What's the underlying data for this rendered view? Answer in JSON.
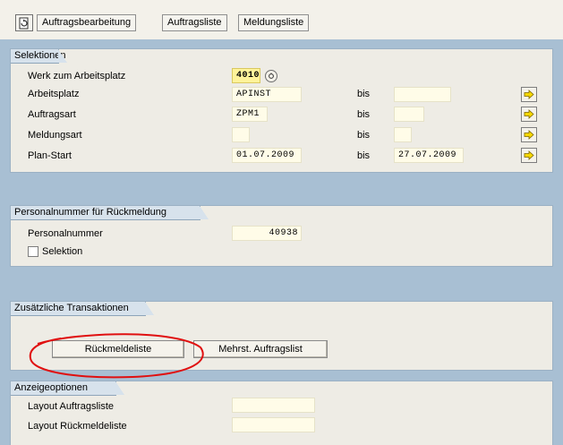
{
  "toolbar": {
    "icon": "document-refresh-icon",
    "buttons": [
      "Auftragsbearbeitung",
      "Auftragsliste",
      "Meldungsliste"
    ]
  },
  "selektionen": {
    "title": "Selektionen",
    "werk": {
      "label": "Werk zum Arbeitsplatz",
      "value": "4010"
    },
    "to_label": "bis",
    "rows": [
      {
        "label": "Arbeitsplatz",
        "from": "APINST",
        "to": ""
      },
      {
        "label": "Auftragsart",
        "from": "ZPM1",
        "to": ""
      },
      {
        "label": "Meldungsart",
        "from": "",
        "to": ""
      },
      {
        "label": "Plan-Start",
        "from": "01.07.2009",
        "to": "27.07.2009"
      }
    ]
  },
  "personal": {
    "title": "Personalnummer für Rückmeldung",
    "label": "Personalnummer",
    "value": "40938",
    "checkbox_label": "Selektion",
    "checked": false
  },
  "transaktionen": {
    "title": "Zusätzliche Transaktionen",
    "btn1": "Rückmeldeliste",
    "btn2": "Mehrst. Auftragslist"
  },
  "anzeige": {
    "title": "Anzeigeoptionen",
    "layout_auftragsliste": {
      "label": "Layout Auftragsliste",
      "value": ""
    },
    "layout_rueckmeldeliste": {
      "label": "Layout Rückmeldeliste",
      "value": ""
    }
  },
  "colors": {
    "band": "#a8bfd3",
    "panel": "#eeece5",
    "input": "#fffce8",
    "highlight": "#fff39a",
    "annotation": "#e01010"
  }
}
